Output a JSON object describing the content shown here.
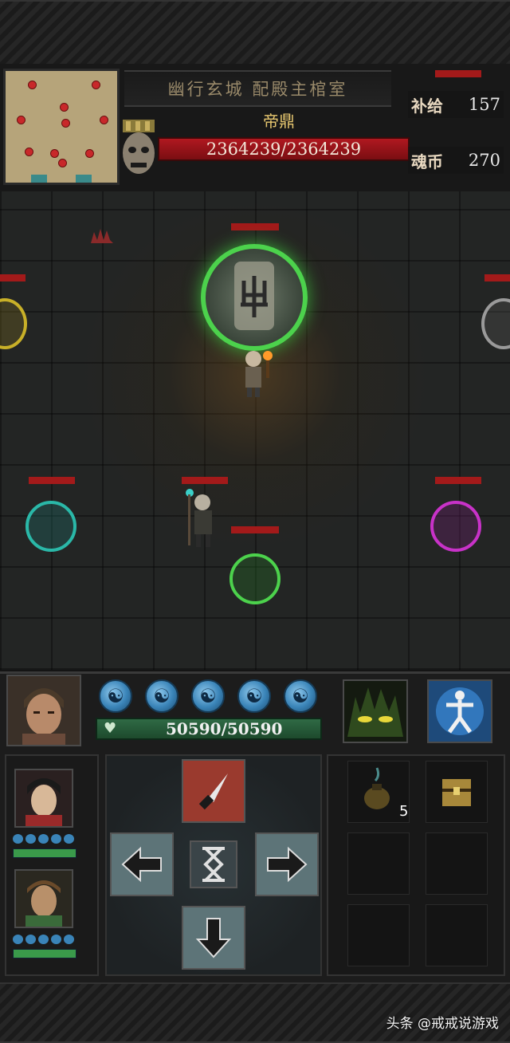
{
  "location": {
    "name": "幽行玄城 配殿主棺室"
  },
  "boss": {
    "name": "帝鼎",
    "hp": "2364239/2364239"
  },
  "resources": {
    "supply_label": "补给",
    "supply_value": "157",
    "coin_label": "魂币",
    "coin_value": "270"
  },
  "player": {
    "hp": "50590/50590",
    "spirit_orbs": 5
  },
  "inventory": {
    "item1_count": "5"
  },
  "watermark": {
    "text": "头条 @戒戒说游戏"
  },
  "colors": {
    "boss_hp": "#b01820",
    "player_hp": "#2f6a45",
    "spirit_orb": "#3a84b8",
    "jar_green": "#4cd24c",
    "jar_yellow": "#c8b028",
    "jar_cyan": "#2ab8a8",
    "jar_magenta": "#c832c8"
  },
  "icons": {
    "attack": "dagger-icon",
    "wait": "hourglass-icon",
    "moves": [
      "arrow-left-icon",
      "arrow-right-icon",
      "arrow-down-icon"
    ],
    "skills": [
      "beast-eyes-icon",
      "martial-stance-icon"
    ]
  }
}
